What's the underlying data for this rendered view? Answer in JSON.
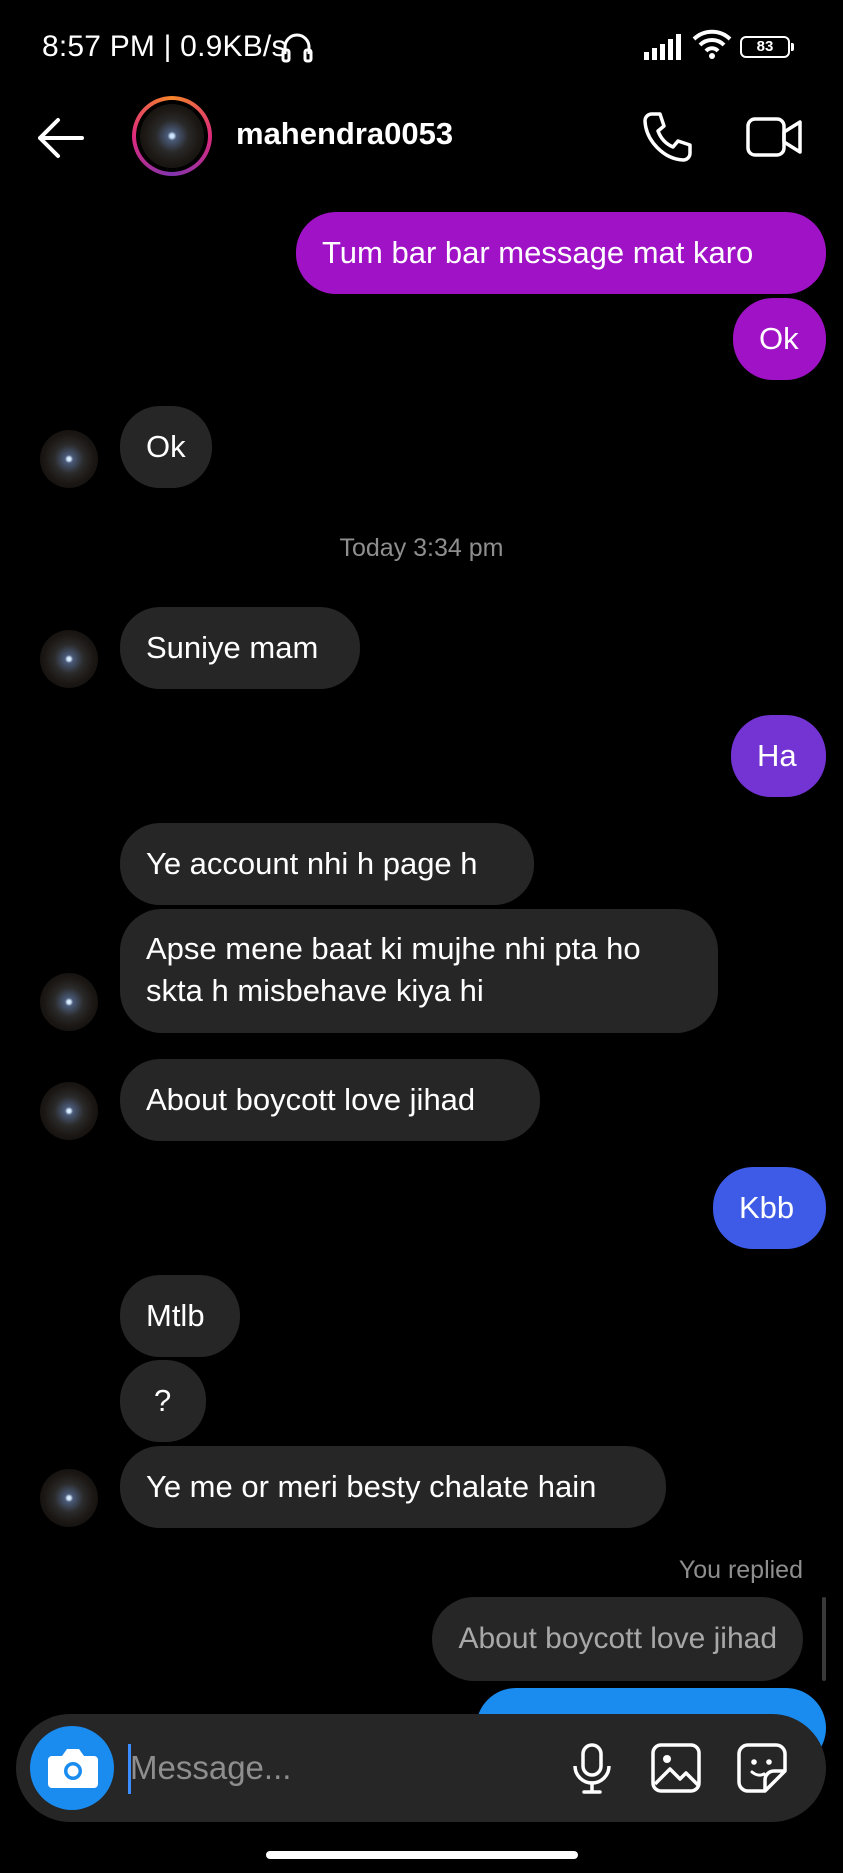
{
  "status_bar": {
    "text": "8:57 PM | 0.9KB/s",
    "battery": "83"
  },
  "header": {
    "username": "mahendra0053"
  },
  "messages": [
    {
      "text": "Tum bar bar message mat karo",
      "direction": "outgoing"
    },
    {
      "text": "Ok",
      "direction": "outgoing"
    },
    {
      "text": "Ok",
      "direction": "incoming"
    },
    {
      "text": "Suniye mam",
      "direction": "incoming"
    },
    {
      "text": "Ha",
      "direction": "outgoing"
    },
    {
      "text": "Ye account nhi h page h",
      "direction": "incoming"
    },
    {
      "text": "Apse mene baat ki mujhe nhi pta ho",
      "text_line2": "skta h misbehave kiya hi",
      "direction": "incoming"
    },
    {
      "text": "About boycott love jihad",
      "direction": "incoming"
    },
    {
      "text": "Kbb",
      "direction": "outgoing"
    },
    {
      "text": "Mtlb",
      "direction": "incoming"
    },
    {
      "text": "?",
      "direction": "incoming"
    },
    {
      "text": "Ye me or meri besty chalate hain",
      "direction": "incoming"
    }
  ],
  "timestamp": "Today 3:34 pm",
  "reply": {
    "label": "You replied",
    "quoted": "About boycott love jihad"
  },
  "composer": {
    "placeholder": "Message..."
  },
  "icons": [
    "back-arrow-icon",
    "phone-icon",
    "video-camera-icon",
    "camera-icon",
    "microphone-icon",
    "gallery-icon",
    "sticker-icon",
    "headphone-icon",
    "signal-icon",
    "wifi-icon",
    "battery-icon"
  ],
  "colors": {
    "outgoing_purple": "#a012c6",
    "outgoing_violet": "#7434d4",
    "outgoing_blue": "#3d5be6",
    "incoming_bubble": "#262626",
    "accent_blue": "#1a8cf0"
  }
}
